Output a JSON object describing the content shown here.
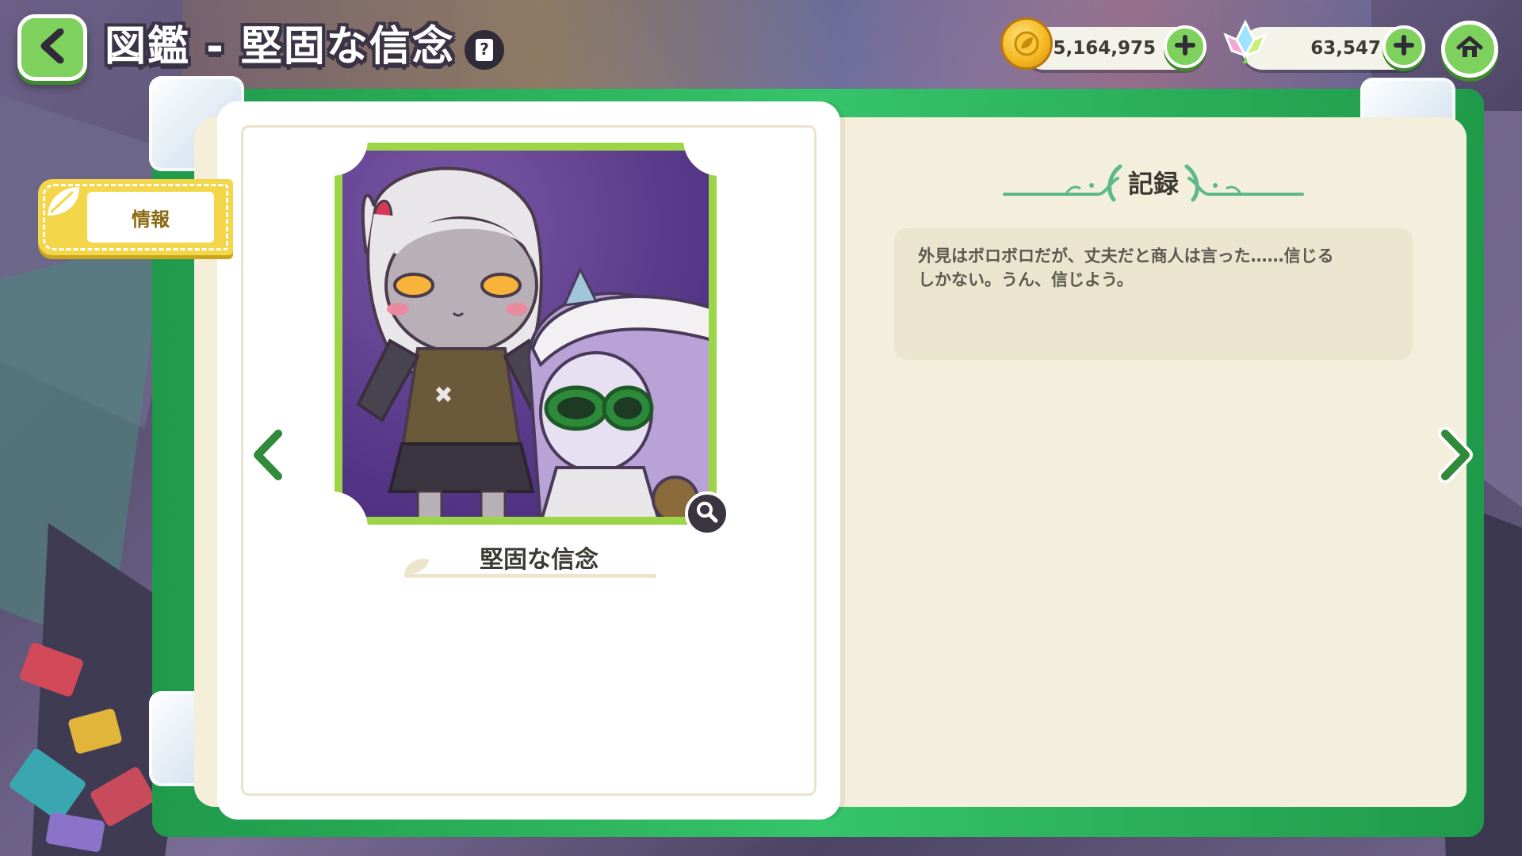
{
  "header": {
    "title": "図鑑 - 堅固な信念",
    "help_label": "?"
  },
  "currencies": {
    "coins": "5,164,975",
    "gems": "63,547"
  },
  "tabs": {
    "info_label": "情報"
  },
  "item": {
    "name": "堅固な信念"
  },
  "record": {
    "title": "記録",
    "text": "外見はボロボロだが、丈夫だと商人は言った……信じる\nしかない。うん、信じよう。"
  },
  "colors": {
    "accent_green": "#7fd15e",
    "frame_green": "#36c46a",
    "tab_yellow": "#f4d64a",
    "page_cream": "#f4efdd"
  },
  "icons": {
    "back": "chevron-left-icon",
    "help": "question-icon",
    "coin": "coin-icon",
    "gem": "crystal-icon",
    "plus": "plus-icon",
    "home": "home-icon",
    "zoom": "magnifier-icon",
    "prev": "chevron-left-icon",
    "next": "chevron-right-icon"
  }
}
